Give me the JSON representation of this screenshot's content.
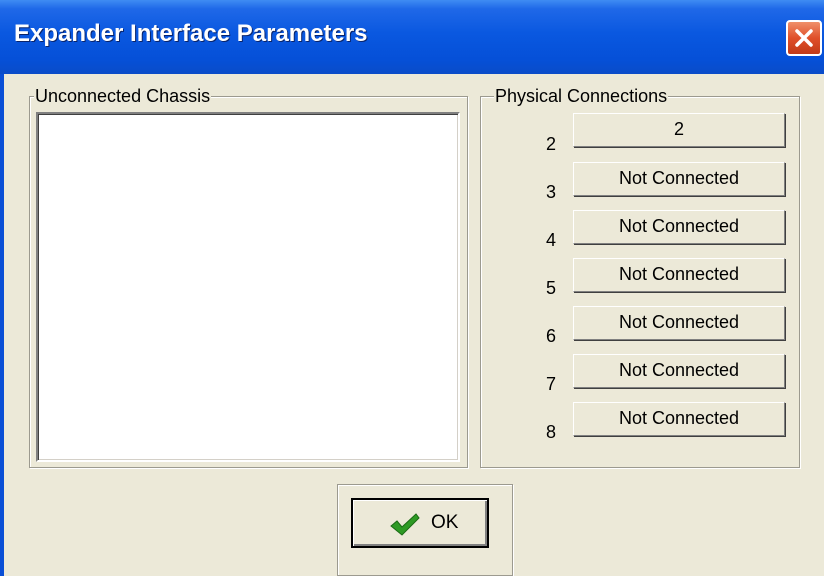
{
  "window": {
    "title": "Expander Interface Parameters",
    "accent": "#0a58e0",
    "close_icon": "close-icon"
  },
  "unconnected": {
    "label": "Unconnected Chassis",
    "items": []
  },
  "physical": {
    "label": "Physical Connections",
    "connections": [
      {
        "number": "2",
        "value": "2"
      },
      {
        "number": "3",
        "value": "Not Connected"
      },
      {
        "number": "4",
        "value": "Not Connected"
      },
      {
        "number": "5",
        "value": "Not Connected"
      },
      {
        "number": "6",
        "value": "Not Connected"
      },
      {
        "number": "7",
        "value": "Not Connected"
      },
      {
        "number": "8",
        "value": "Not Connected"
      }
    ]
  },
  "ok_button": {
    "label": "OK",
    "icon": "checkmark-icon",
    "icon_color": "#2e9a24"
  }
}
